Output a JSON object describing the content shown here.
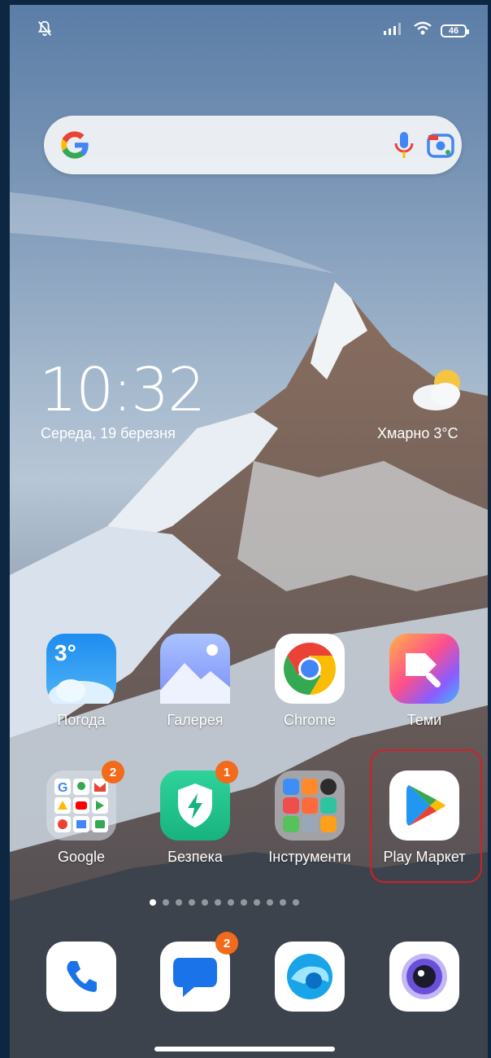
{
  "status_bar": {
    "battery": "46"
  },
  "clock": {
    "time": "10:32",
    "date": "Середа, 19 березня"
  },
  "weather": {
    "text": "Хмарно  3°C"
  },
  "apps_row1": [
    {
      "label": "Погода",
      "icon": "weather-app-icon",
      "icon_text": "3°"
    },
    {
      "label": "Галерея",
      "icon": "gallery-icon"
    },
    {
      "label": "Chrome",
      "icon": "chrome-icon"
    },
    {
      "label": "Теми",
      "icon": "themes-icon"
    }
  ],
  "apps_row2": [
    {
      "label": "Google",
      "icon": "google-folder-icon",
      "badge": "2"
    },
    {
      "label": "Безпека",
      "icon": "security-icon",
      "badge": "1"
    },
    {
      "label": "Інструменти",
      "icon": "tools-folder-icon"
    },
    {
      "label": "Play Маркет",
      "icon": "play-store-icon"
    }
  ],
  "dock": [
    {
      "icon": "phone-icon"
    },
    {
      "icon": "messages-icon",
      "badge": "2"
    },
    {
      "icon": "browser-icon"
    },
    {
      "icon": "camera-icon"
    }
  ],
  "colors": {
    "highlight": "#d0202a",
    "badge": "#f26a1b"
  }
}
